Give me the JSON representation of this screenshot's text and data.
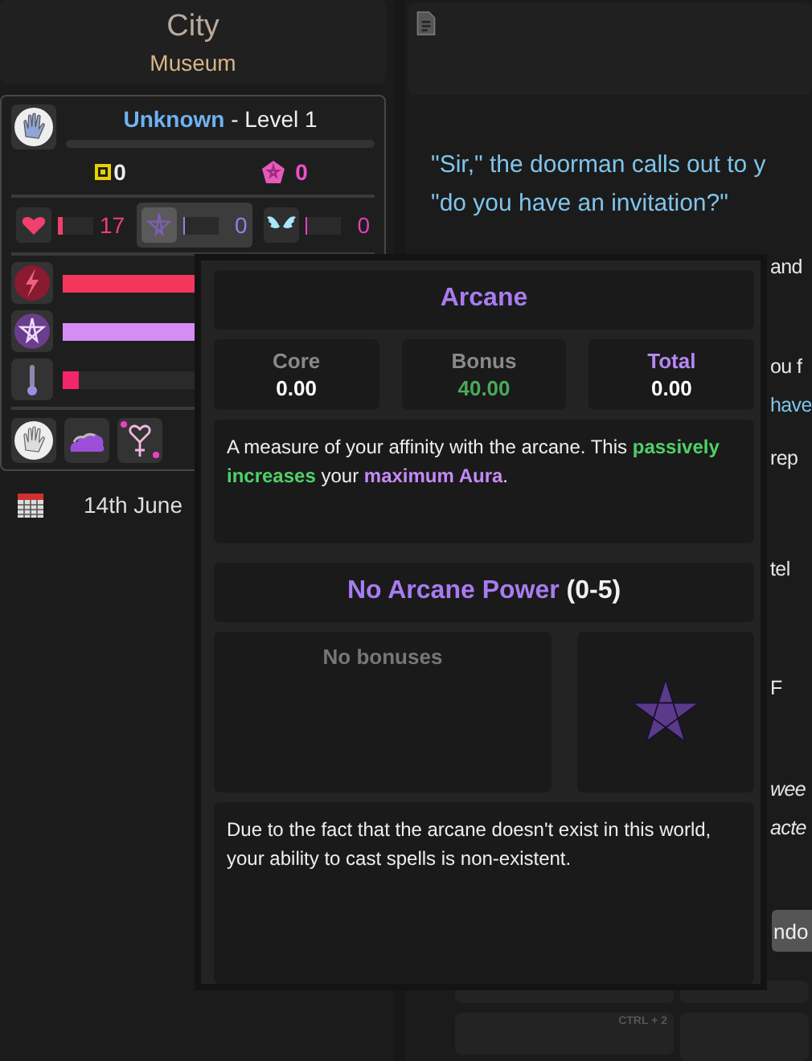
{
  "location": {
    "city": "City",
    "place": "Museum"
  },
  "character": {
    "name": "Unknown",
    "level_text": " - Level 1",
    "currencies": [
      {
        "kind": "coin",
        "value": "0"
      },
      {
        "kind": "gem",
        "value": "0"
      }
    ],
    "stats": [
      {
        "kind": "heart",
        "value": "17",
        "level": 0.12,
        "selected": false
      },
      {
        "kind": "star",
        "value": "0",
        "level": 0,
        "selected": true
      },
      {
        "kind": "wings",
        "value": "0",
        "level": 0,
        "selected": false
      }
    ],
    "bars": [
      {
        "kind": "energy",
        "level": 1
      },
      {
        "kind": "aura",
        "level": 1
      },
      {
        "kind": "heat",
        "level": 0.05
      }
    ],
    "status_icons": [
      {
        "kind": "hand"
      },
      {
        "kind": "cloud"
      },
      {
        "kind": "venus"
      }
    ]
  },
  "date": "14th June",
  "story": {
    "quote_lines": [
      "\"Sir,\" the doorman calls out to y",
      "\"do you have an invitation?\""
    ],
    "fragments": [
      {
        "text": "and",
        "kind": "plain"
      },
      {
        "text": "ou f",
        "kind": "plain"
      },
      {
        "text": "have",
        "kind": "speech"
      },
      {
        "text": "rep",
        "kind": "plain"
      },
      {
        "text": "tel",
        "kind": "plain"
      },
      {
        "text": "F",
        "kind": "plain"
      },
      {
        "text": "wee",
        "kind": "italic"
      },
      {
        "text": "acte",
        "kind": "italic"
      }
    ],
    "button_fragment": "ndo",
    "shortcut": "CTRL + 2"
  },
  "tooltip": {
    "title": "Arcane",
    "stats": [
      {
        "label": "Core",
        "value": "0.00",
        "kind": "core"
      },
      {
        "label": "Bonus",
        "value": "40.00",
        "kind": "bonus"
      },
      {
        "label": "Total",
        "value": "0.00",
        "kind": "total"
      }
    ],
    "description": [
      {
        "text": "A measure of your affinity with the arcane. This ",
        "kind": "plain"
      },
      {
        "text": "passively increases",
        "kind": "good"
      },
      {
        "text": " your ",
        "kind": "plain"
      },
      {
        "text": "maximum Aura",
        "kind": "magic"
      },
      {
        "text": ".",
        "kind": "plain"
      }
    ],
    "power_name": "No Arcane Power",
    "power_range": " (0-5)",
    "bonuses": "No bonuses",
    "power_description": "Due to the fact that the arcane doesn't exist in this world, your ability to cast spells is non-existent."
  }
}
